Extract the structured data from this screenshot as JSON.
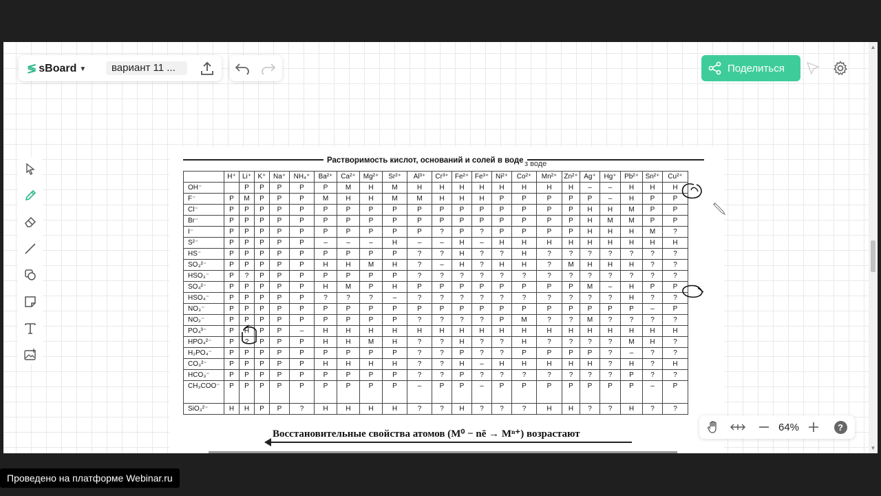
{
  "app": {
    "logo_text": "sBoard",
    "board_name": "вариант 11 ...",
    "share_label": "Поделиться",
    "accent_color": "#3ecd9a"
  },
  "toolbar": {
    "tools": [
      "select-icon",
      "pen-icon",
      "eraser-icon",
      "line-icon",
      "shapes-icon",
      "sticky-note-icon",
      "text-icon",
      "image-icon"
    ],
    "active_tool": "pen-icon"
  },
  "zoom": {
    "value": "64%"
  },
  "footer": {
    "label": "Проведено на платформе Webinar.ru"
  },
  "document": {
    "title": "Растворимость кислот, оснований и солей в воде",
    "title_tail": "з воде",
    "cations": [
      "H⁺",
      "Li⁺",
      "K⁺",
      "Na⁺",
      "NH₄⁺",
      "Ba²⁺",
      "Ca²⁺",
      "Mg²⁺",
      "Sr²⁺",
      "Al³⁺",
      "Cr³⁺",
      "Fe²⁺",
      "Fe³⁺",
      "Ni²⁺",
      "Co²⁺",
      "Mn²⁺",
      "Zn²⁺",
      "Ag⁺",
      "Hg⁺",
      "Pb²⁺",
      "Sn²⁺",
      "Cu²⁺"
    ],
    "rows": [
      {
        "anion": "OH⁻",
        "cells": [
          "",
          "Р",
          "Р",
          "Р",
          "Р",
          "Р",
          "М",
          "Н",
          "М",
          "Н",
          "Н",
          "Н",
          "Н",
          "Н",
          "Н",
          "Н",
          "Н",
          "–",
          "–",
          "Н",
          "Н",
          "Н"
        ]
      },
      {
        "anion": "F⁻",
        "cells": [
          "Р",
          "М",
          "Р",
          "Р",
          "Р",
          "М",
          "Н",
          "Н",
          "М",
          "М",
          "Н",
          "Н",
          "Н",
          "Р",
          "Р",
          "Р",
          "Р",
          "Р",
          "–",
          "Н",
          "Р",
          "Р"
        ]
      },
      {
        "anion": "Cl⁻",
        "cells": [
          "Р",
          "Р",
          "Р",
          "Р",
          "Р",
          "Р",
          "Р",
          "Р",
          "Р",
          "Р",
          "Р",
          "Р",
          "Р",
          "Р",
          "Р",
          "Р",
          "Р",
          "Н",
          "Н",
          "М",
          "Р",
          "Р"
        ]
      },
      {
        "anion": "Br⁻",
        "cells": [
          "Р",
          "Р",
          "Р",
          "Р",
          "Р",
          "Р",
          "Р",
          "Р",
          "Р",
          "Р",
          "Р",
          "Р",
          "Р",
          "Р",
          "Р",
          "Р",
          "Р",
          "Н",
          "М",
          "М",
          "Р",
          "Р"
        ]
      },
      {
        "anion": "I⁻",
        "cells": [
          "Р",
          "Р",
          "Р",
          "Р",
          "Р",
          "Р",
          "Р",
          "Р",
          "Р",
          "Р",
          "?",
          "Р",
          "?",
          "Р",
          "Р",
          "Р",
          "Р",
          "Н",
          "Н",
          "Н",
          "М",
          "?"
        ]
      },
      {
        "anion": "S²⁻",
        "cells": [
          "Р",
          "Р",
          "Р",
          "Р",
          "Р",
          "–",
          "–",
          "–",
          "Н",
          "–",
          "–",
          "Н",
          "–",
          "Н",
          "Н",
          "Н",
          "Н",
          "Н",
          "Н",
          "Н",
          "Н",
          "Н"
        ]
      },
      {
        "anion": "HS⁻",
        "cells": [
          "Р",
          "Р",
          "Р",
          "Р",
          "Р",
          "Р",
          "Р",
          "Р",
          "Р",
          "?",
          "?",
          "Н",
          "?",
          "?",
          "Н",
          "?",
          "?",
          "?",
          "?",
          "?",
          "?",
          "?"
        ]
      },
      {
        "anion": "SO₃²⁻",
        "cells": [
          "Р",
          "Р",
          "Р",
          "Р",
          "Р",
          "Н",
          "Н",
          "М",
          "Н",
          "?",
          "–",
          "Н",
          "?",
          "Н",
          "Н",
          "?",
          "М",
          "Н",
          "Н",
          "Н",
          "?",
          "?"
        ]
      },
      {
        "anion": "HSO₃⁻",
        "cells": [
          "Р",
          "?",
          "Р",
          "Р",
          "Р",
          "Р",
          "Р",
          "Р",
          "Р",
          "?",
          "?",
          "?",
          "?",
          "?",
          "?",
          "?",
          "?",
          "?",
          "?",
          "?",
          "?",
          "?"
        ]
      },
      {
        "anion": "SO₄²⁻",
        "cells": [
          "Р",
          "Р",
          "Р",
          "Р",
          "Р",
          "Н",
          "М",
          "Р",
          "Н",
          "Р",
          "Р",
          "Р",
          "Р",
          "Р",
          "Р",
          "Р",
          "Р",
          "М",
          "–",
          "Н",
          "Р",
          "Р"
        ]
      },
      {
        "anion": "HSO₄⁻",
        "cells": [
          "Р",
          "Р",
          "Р",
          "Р",
          "Р",
          "?",
          "?",
          "?",
          "–",
          "?",
          "?",
          "?",
          "?",
          "?",
          "?",
          "?",
          "?",
          "?",
          "?",
          "Н",
          "?",
          "?"
        ]
      },
      {
        "anion": "NO₃⁻",
        "cells": [
          "Р",
          "Р",
          "Р",
          "Р",
          "Р",
          "Р",
          "Р",
          "Р",
          "Р",
          "Р",
          "Р",
          "Р",
          "Р",
          "Р",
          "Р",
          "Р",
          "Р",
          "Р",
          "Р",
          "Р",
          "–",
          "Р"
        ]
      },
      {
        "anion": "NO₂⁻",
        "cells": [
          "Р",
          "Р",
          "Р",
          "Р",
          "Р",
          "Р",
          "Р",
          "Р",
          "Р",
          "?",
          "?",
          "?",
          "?",
          "Р",
          "М",
          "?",
          "?",
          "М",
          "?",
          "?",
          "?",
          "?"
        ]
      },
      {
        "anion": "PO₄³⁻",
        "cells": [
          "Р",
          "Н",
          "Р",
          "Р",
          "–",
          "Н",
          "Н",
          "Н",
          "Н",
          "Н",
          "Н",
          "Н",
          "Н",
          "Н",
          "Н",
          "Н",
          "Н",
          "Н",
          "Н",
          "Н",
          "Н",
          "Н"
        ]
      },
      {
        "anion": "HPO₄²⁻",
        "cells": [
          "Р",
          "?",
          "Р",
          "Р",
          "Р",
          "Н",
          "Н",
          "М",
          "Н",
          "?",
          "?",
          "Н",
          "?",
          "?",
          "Н",
          "?",
          "?",
          "?",
          "?",
          "М",
          "Н",
          "?"
        ]
      },
      {
        "anion": "H₂PO₄⁻",
        "cells": [
          "Р",
          "Р",
          "Р",
          "Р",
          "Р",
          "Р",
          "Р",
          "Р",
          "Р",
          "?",
          "?",
          "Р",
          "?",
          "?",
          "Р",
          "Р",
          "Р",
          "Р",
          "?",
          "–",
          "?",
          "?"
        ]
      },
      {
        "anion": "CO₃²⁻",
        "cells": [
          "Р",
          "Р",
          "Р",
          "Р",
          "Р",
          "Н",
          "Н",
          "Н",
          "Н",
          "?",
          "?",
          "Н",
          "–",
          "Н",
          "Н",
          "Н",
          "Н",
          "Н",
          "?",
          "Н",
          "?",
          "Н"
        ]
      },
      {
        "anion": "HCO₃⁻",
        "cells": [
          "Р",
          "Р",
          "Р",
          "Р",
          "Р",
          "Р",
          "Р",
          "Р",
          "Р",
          "?",
          "?",
          "Р",
          "?",
          "?",
          "?",
          "?",
          "?",
          "?",
          "?",
          "Р",
          "?",
          "?"
        ]
      },
      {
        "anion": "CH₃COO⁻",
        "cells": [
          "Р",
          "Р",
          "Р",
          "Р",
          "Р",
          "Р",
          "Р",
          "Р",
          "Р",
          "–",
          "Р",
          "Р",
          "–",
          "Р",
          "Р",
          "Р",
          "Р",
          "Р",
          "Р",
          "Р",
          "–",
          "Р"
        ]
      },
      {
        "anion": "SiO₃²⁻",
        "cells": [
          "Н",
          "Н",
          "Р",
          "Р",
          "?",
          "Н",
          "Н",
          "Н",
          "Н",
          "?",
          "?",
          "Н",
          "?",
          "?",
          "?",
          "Н",
          "Н",
          "?",
          "?",
          "Н",
          "?",
          "?"
        ]
      }
    ],
    "caption_prefix": "Восстановительные свойства атомов (",
    "caption_formula": "M⁰ − nē → Mⁿ⁺",
    "caption_suffix": ") возрастают"
  }
}
